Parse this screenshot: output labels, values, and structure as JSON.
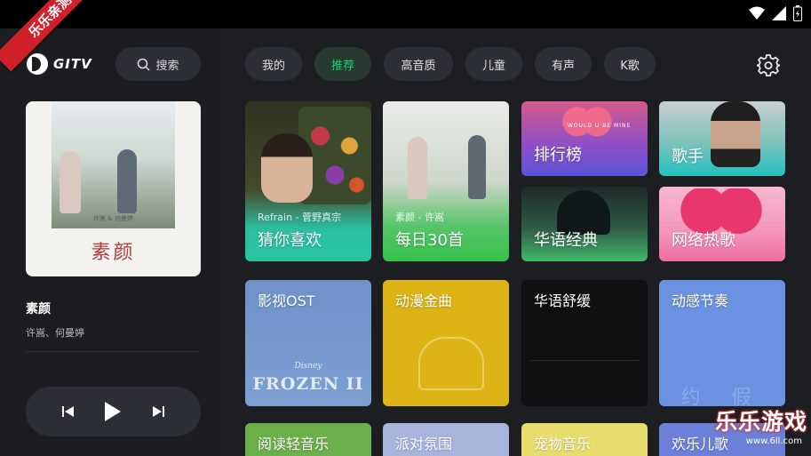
{
  "status_bar": {
    "icons": [
      "wifi-icon",
      "signal-icon",
      "battery-icon"
    ]
  },
  "ribbon": {
    "text": "乐乐亲测"
  },
  "sidebar": {
    "brand": "GITV",
    "search_label": "搜索",
    "now_playing": {
      "cover_artist": "许嵩 & 何曼婷",
      "cover_album": "素颜",
      "title": "素颜",
      "artist": "许嵩、何曼婷"
    }
  },
  "tabs": [
    {
      "label": "我的",
      "active": false
    },
    {
      "label": "推荐",
      "active": true
    },
    {
      "label": "高音质",
      "active": false
    },
    {
      "label": "儿童",
      "active": false
    },
    {
      "label": "有声",
      "active": false
    },
    {
      "label": "K歌",
      "active": false
    }
  ],
  "tiles": {
    "guess": {
      "label": "猜你喜欢",
      "sub": "Refrain - 菅野真宗"
    },
    "daily": {
      "label": "每日30首",
      "sub": "素颜 - 许嵩"
    },
    "rank": {
      "label": "排行榜",
      "tiny": "WOULD U BE MINE"
    },
    "singer": {
      "label": "歌手"
    },
    "chinese_classic": {
      "label": "华语经典"
    },
    "net_hot": {
      "label": "网络热歌"
    },
    "ost": {
      "label": "影视OST",
      "disney": "Disney",
      "frozen": "FROZEN II"
    },
    "anime": {
      "label": "动漫金曲"
    },
    "soothe": {
      "label": "华语舒缓"
    },
    "dynamic": {
      "label": "动感节奏",
      "wm": "约 假 我"
    },
    "reading": {
      "label": "阅读轻音乐"
    },
    "party": {
      "label": "派对氛围"
    },
    "pet": {
      "label": "宠物音乐"
    },
    "kids": {
      "label": "欢乐儿歌"
    }
  },
  "watermark": {
    "text": "乐乐游戏",
    "url": "www.6ll.com"
  },
  "colors": {
    "accent": "#21d07a",
    "background": "#1d1e22",
    "pill": "#2d2f36"
  }
}
